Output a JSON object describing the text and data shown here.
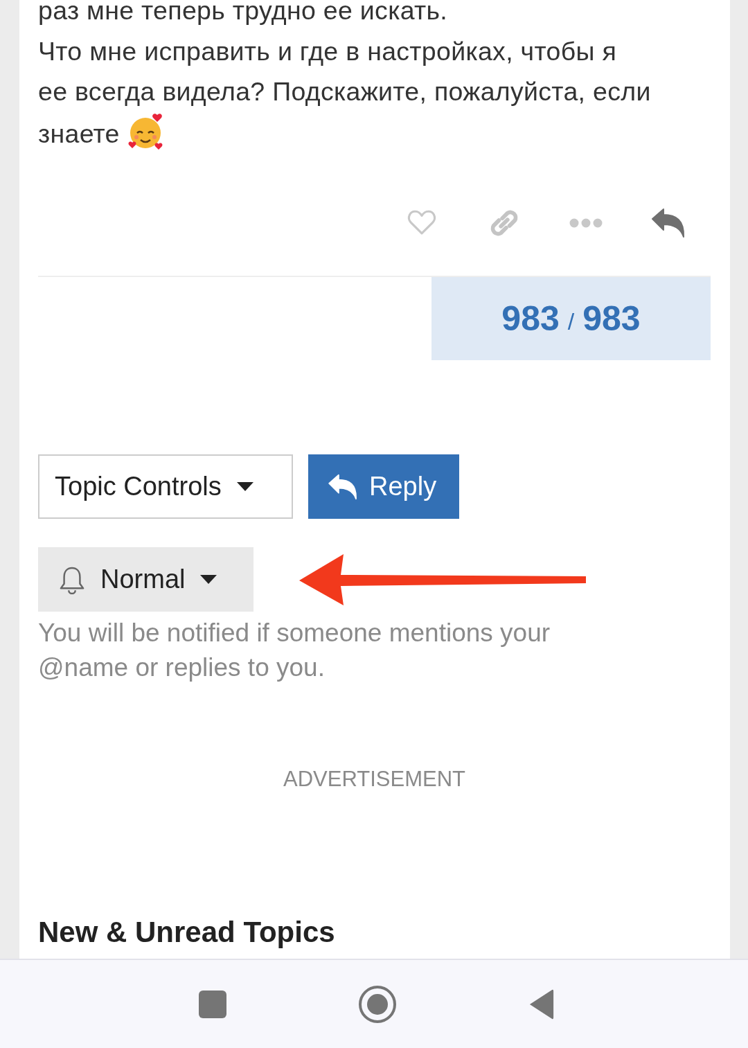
{
  "post": {
    "lines": [
      "раз мне теперь трудно ее искать.",
      "Что мне исправить и где в настройках, чтобы я",
      "ее всегда видела? Подскажите, пожалуйста, если",
      "знаете"
    ]
  },
  "post_actions": [
    {
      "kind": "like"
    },
    {
      "kind": "link"
    },
    {
      "kind": "more"
    },
    {
      "kind": "reply"
    }
  ],
  "progress": {
    "current": "983",
    "separator": "/",
    "total": "983"
  },
  "topic_controls": {
    "label": "Topic Controls"
  },
  "reply_button": {
    "label": "Reply"
  },
  "notifications": {
    "label": "Normal",
    "description": "You will be notified if someone mentions your @name or replies to you."
  },
  "advertisement": "ADVERTISEMENT",
  "section_heading": "New & Unread Topics",
  "nav_bar": [
    {
      "kind": "recents"
    },
    {
      "kind": "home"
    },
    {
      "kind": "back"
    }
  ]
}
